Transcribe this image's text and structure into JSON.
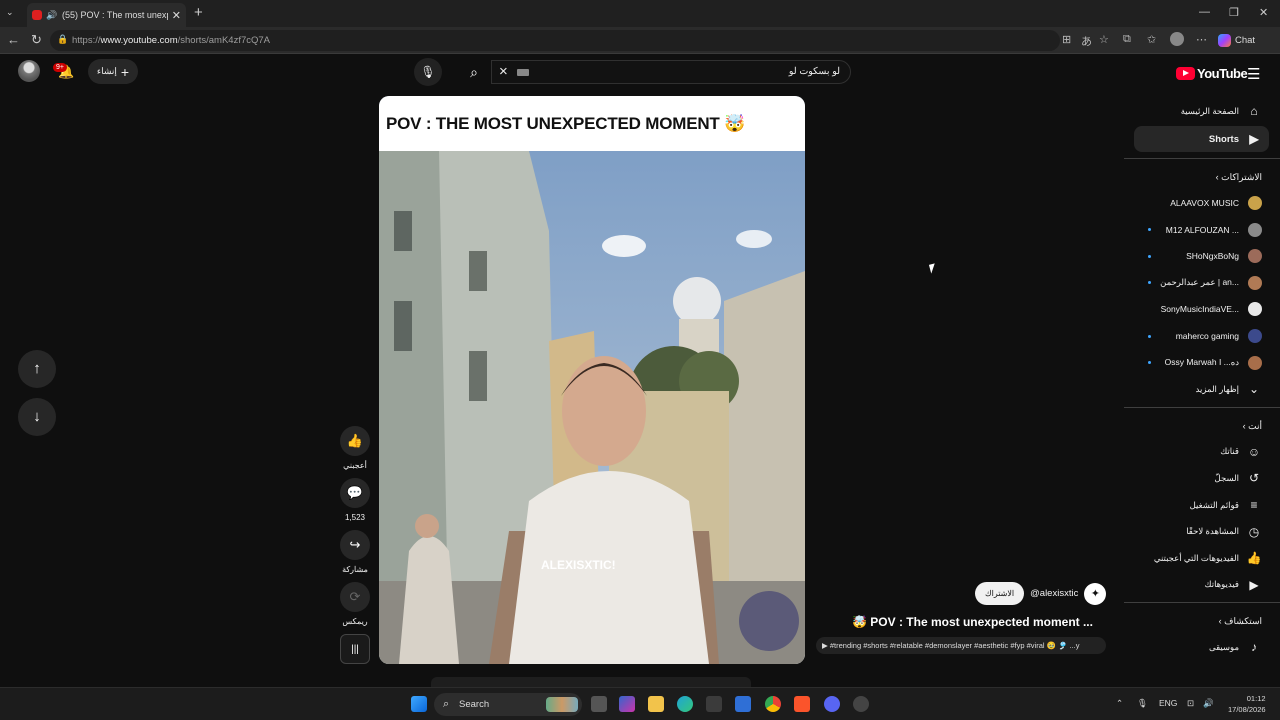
{
  "browser": {
    "tab_title": "(55) POV : The most unexpected",
    "url_domain": "www.youtube.com",
    "url_prefix": "https://",
    "url_path": "/shorts/amK4zf7cQ7A",
    "chat_label": "Chat"
  },
  "header": {
    "logo_text": "YouTube",
    "search_query": "لو بسكوت لو",
    "create_label": "إنشاء",
    "notification_badge": "9+"
  },
  "sidebar": {
    "main": [
      {
        "label": "الصفحة الرئيسية",
        "icon": "home-icon",
        "glyph": "⌂"
      },
      {
        "label": "Shorts",
        "icon": "shorts-icon",
        "glyph": "▶"
      }
    ],
    "subscriptions_title": "الاشتراكات",
    "subscriptions": [
      {
        "label": "ALAAVOX MUSIC",
        "dot": false,
        "color": "#c9a24a"
      },
      {
        "label": "M12 ALFOUZAN ...",
        "dot": true,
        "color": "#8a8a8a"
      },
      {
        "label": "SHoNgxBoNg",
        "dot": true,
        "color": "#9c6b5a"
      },
      {
        "label": "عمر عبدالرحمن | an...",
        "dot": true,
        "color": "#b07a55"
      },
      {
        "label": "SonyMusicIndiaVE...",
        "dot": false,
        "color": "#e8e8e8"
      },
      {
        "label": "maherco gaming",
        "dot": true,
        "color": "#3c4a8c"
      },
      {
        "label": "Ossy Marwah I ...ده",
        "dot": true,
        "color": "#a86e4a"
      }
    ],
    "show_more": "إظهار المزيد",
    "you_title": "أنت",
    "you": [
      {
        "label": "قناتك",
        "glyph": "☺"
      },
      {
        "label": "السجلّ",
        "glyph": "↺"
      },
      {
        "label": "قوائم التشغيل",
        "glyph": "≡"
      },
      {
        "label": "المشاهدة لاحقًا",
        "glyph": "◷"
      },
      {
        "label": "الفيديوهات التي أعجبتني",
        "glyph": "👍"
      },
      {
        "label": "فيديوهاتك",
        "glyph": "▶"
      }
    ],
    "explore_title": "استكشاف",
    "explore": [
      {
        "label": "موسيقى",
        "glyph": "♪"
      }
    ]
  },
  "short": {
    "overlay_title": "POV : THE MOST UNEXPECTED MOMENT 🤯",
    "watermark": "ALEXISXTIC!",
    "like_label": "أعجبني",
    "comments_count": "1,523",
    "share_label": "مشاركة",
    "remix_label": "ريمكس",
    "channel_handle": "@alexisxtic",
    "subscribe_label": "الاشتراك",
    "title": "🤯 POV : The most unexpected moment ...",
    "tags": "▶ #trending #shorts #relatable #demonslayer #aesthetic #fyp #viral 🥹 🎐 ...y"
  },
  "taskbar": {
    "search_label": "Search",
    "lang": "ENG",
    "time": "01:12",
    "date": "17/08/2026"
  },
  "colors": {
    "brand_red": "#ff0033",
    "background": "#0f0f0f",
    "link_blue": "#3ea6ff"
  }
}
